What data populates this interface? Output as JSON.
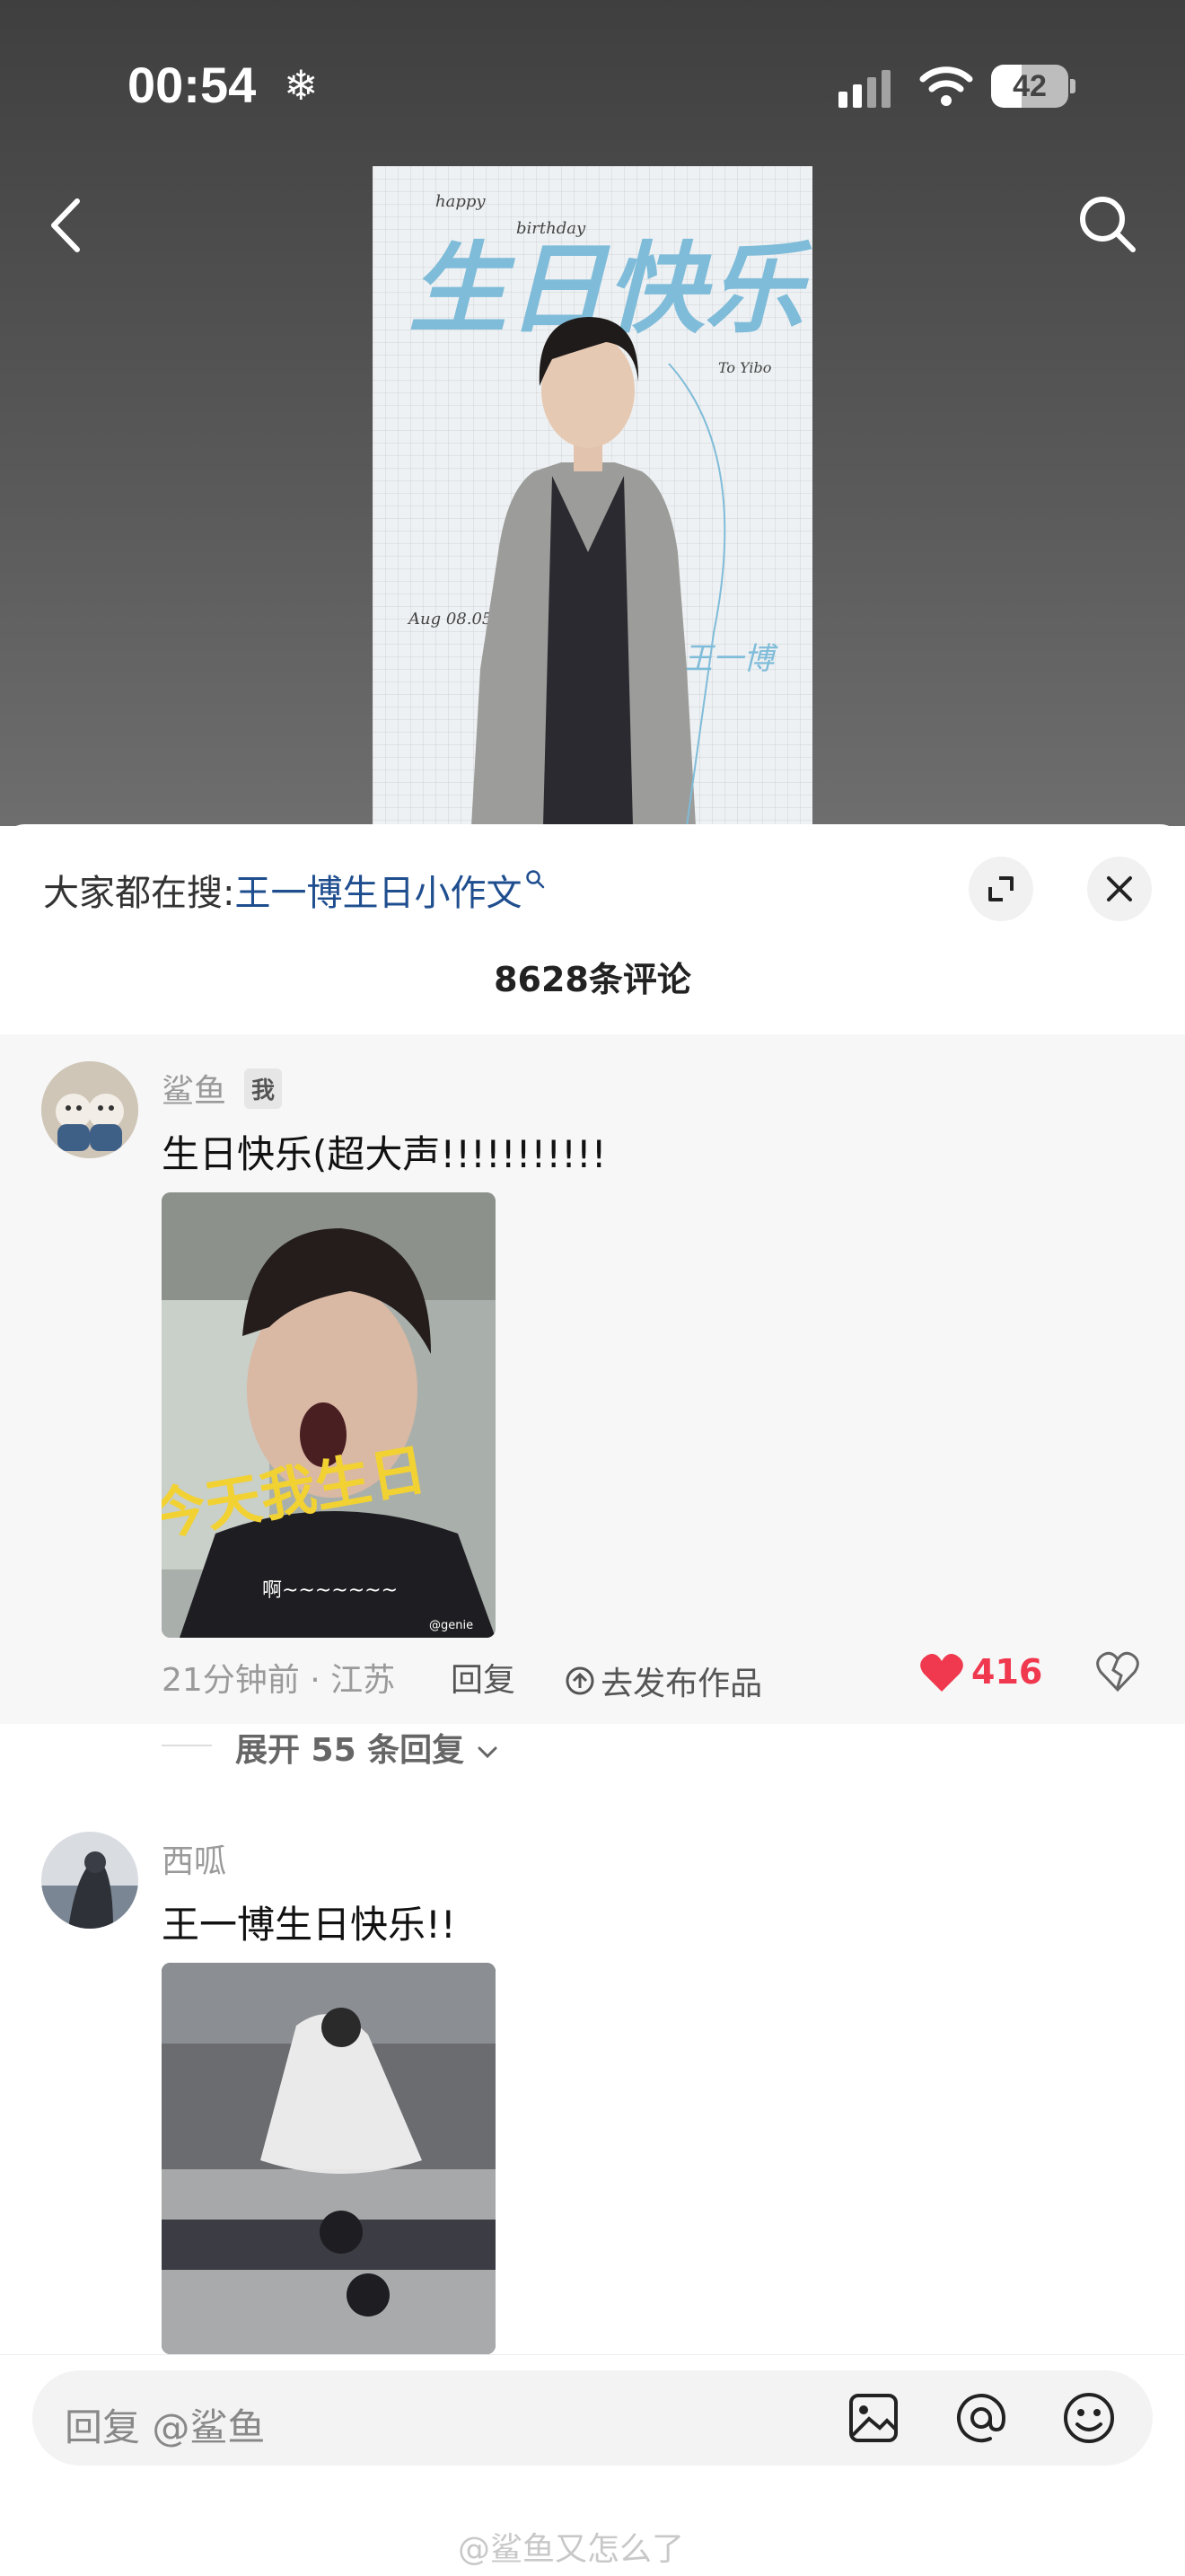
{
  "status_bar": {
    "time": "00:54",
    "snow_glyph": "❄",
    "battery": "42"
  },
  "poster": {
    "title": "生日快乐",
    "happy": "happy",
    "birthday": "birthday",
    "to": "To Yibo",
    "date": "Aug 08.05",
    "signature": "王一博"
  },
  "hot_search": {
    "prefix": "大家都在搜:",
    "term": "王一博生日小作文",
    "glyph": "🔍"
  },
  "comment_count": "8628条评论",
  "comments": [
    {
      "username": "鲨鱼",
      "badge": "我",
      "text": "生日快乐(超大声!!!!!!!!!!!",
      "image_caption": "今天我生日",
      "image_subtitle": "啊~~~~~~~",
      "image_watermark": "@genie",
      "time_location": "21分钟前 · 江苏",
      "reply_label": "回复",
      "publish_label": "去发布作品",
      "likes": "416"
    },
    {
      "username": "西呱",
      "text": "王一博生日快乐!!"
    }
  ],
  "expand_label": "展开 55 条回复",
  "reply_bar": {
    "placeholder": "回复 @鲨鱼"
  },
  "watermark": "@鲨鱼又怎么了",
  "colors": {
    "accent": "#f0384f",
    "link": "#1f4e8f",
    "poster_title": "#7fbcd9"
  },
  "icons": [
    "back-icon",
    "search-icon",
    "expand-icon",
    "close-icon",
    "heart-icon",
    "dislike-icon",
    "image-icon",
    "at-icon",
    "emoji-icon",
    "upload-icon",
    "chevron-down-icon"
  ]
}
